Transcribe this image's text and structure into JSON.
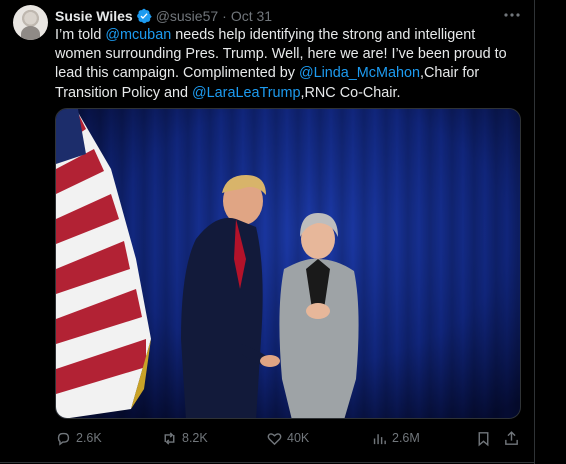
{
  "author": {
    "name": "Susie Wiles",
    "handle": "@susie57",
    "separator": "·",
    "date": "Oct 31"
  },
  "tweet": {
    "segments": [
      {
        "text": "I’m told ",
        "type": "text"
      },
      {
        "text": "@mcuban",
        "type": "mention"
      },
      {
        "text": " needs help identifying the strong and intelligent women surrounding Pres. Trump. Well, here we are! I’ve been proud to lead this campaign. Complimented by ",
        "type": "text"
      },
      {
        "text": "@Linda_McMahon",
        "type": "mention"
      },
      {
        "text": ",Chair for Transition Policy and ",
        "type": "text"
      },
      {
        "text": "@LaraLeaTrump",
        "type": "mention"
      },
      {
        "text": ",RNC Co-Chair.",
        "type": "text"
      }
    ]
  },
  "actions": {
    "replies": "2.6K",
    "reposts": "8.2K",
    "likes": "40K",
    "views": "2.6M"
  },
  "colors": {
    "background": "#000000",
    "text": "#e7e9ea",
    "muted": "#71767b",
    "link": "#1d9bf0",
    "border": "#2f3336"
  },
  "icons": [
    "verified-badge-icon",
    "more-icon",
    "reply-icon",
    "repost-icon",
    "like-icon",
    "views-icon",
    "bookmark-icon",
    "share-icon"
  ]
}
